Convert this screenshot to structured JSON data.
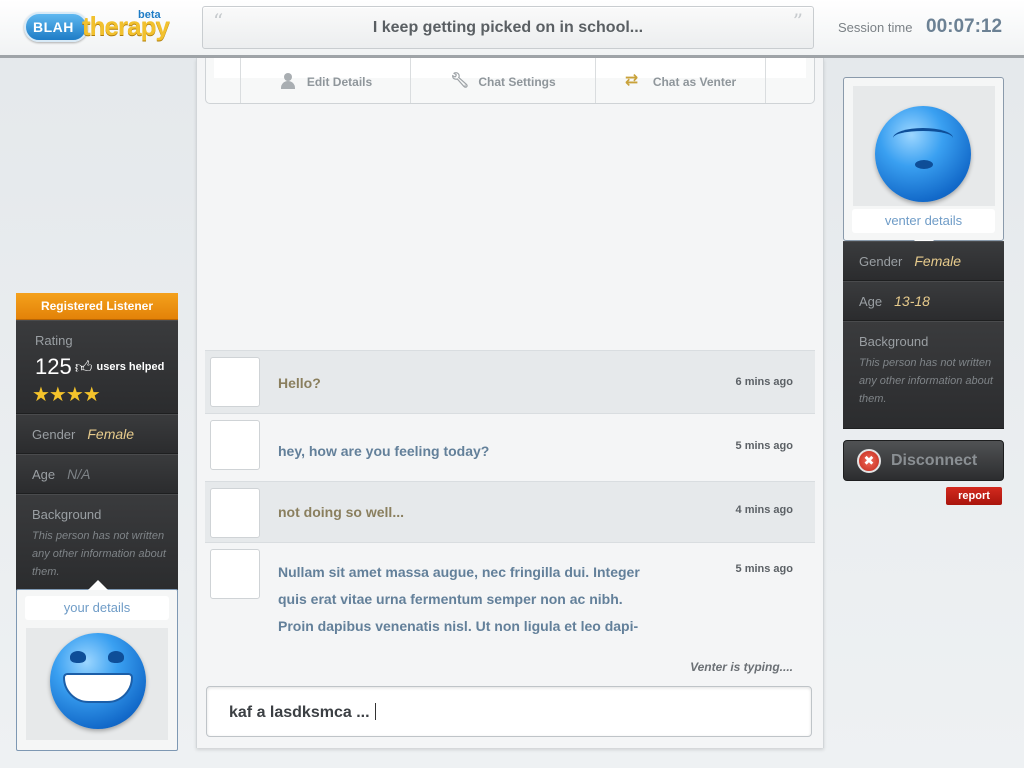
{
  "header": {
    "logo_primary": "BLAH",
    "logo_secondary": "therapy",
    "logo_badge": "beta",
    "topic": "I keep getting picked on in school...",
    "quote_open": "“",
    "quote_close": "”",
    "session_label": "Session time",
    "session_time": "00:07:12"
  },
  "toolbar": {
    "items": [
      {
        "label": "Edit Details",
        "icon": "person-icon"
      },
      {
        "label": "Chat Settings",
        "icon": "wrench-icon"
      },
      {
        "label": "Chat as Venter",
        "icon": "swap-icon"
      }
    ]
  },
  "messages": [
    {
      "author": "venter",
      "text": [
        "Hello?"
      ],
      "time": "6 mins ago"
    },
    {
      "author": "listener",
      "text": [
        "hey, how are you feeling today?"
      ],
      "time": "5 mins ago"
    },
    {
      "author": "venter",
      "text": [
        "not doing so well..."
      ],
      "time": "4 mins ago"
    },
    {
      "author": "listener",
      "text": [
        "Nullam sit amet massa augue, nec fringilla dui. Integer",
        "quis erat vitae urna fermentum semper non ac nibh.",
        "Proin dapibus venenatis nisl. Ut non ligula et leo dapi-"
      ],
      "time": "5 mins ago"
    }
  ],
  "typing_status": "Venter is typing....",
  "composer": {
    "value": "kaf a lasdksmca ..."
  },
  "listener": {
    "header": "Registered Listener",
    "rating_label": "Rating",
    "rating_value": "125",
    "rating_suffix": "users helped",
    "stars": 4,
    "stars_display": "★★★★",
    "gender_label": "Gender",
    "gender_value": "Female",
    "age_label": "Age",
    "age_value": "N/A",
    "background_label": "Background",
    "background_text": "This person has not written any other information about them.",
    "details_label": "your details"
  },
  "venter": {
    "details_label": "venter details",
    "gender_label": "Gender",
    "gender_value": "Female",
    "age_label": "Age",
    "age_value": "13-18",
    "background_label": "Background",
    "background_text": "This person has not written any other information about them."
  },
  "actions": {
    "disconnect_label": "Disconnect",
    "report_label": "report"
  }
}
